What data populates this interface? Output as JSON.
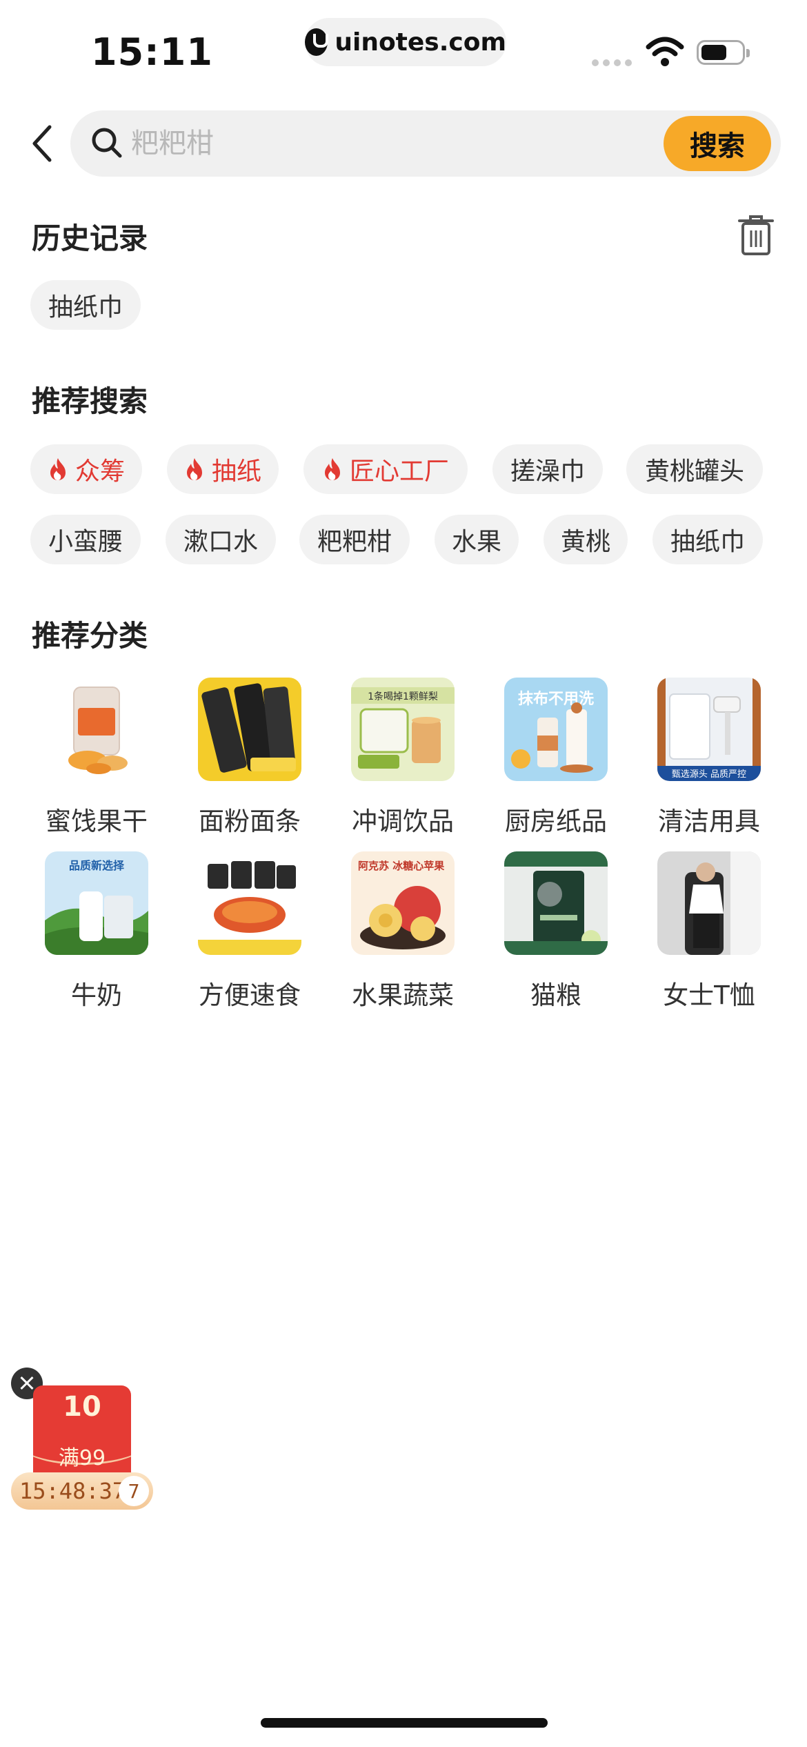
{
  "status_bar": {
    "time": "15:11",
    "url": "uinotes.com"
  },
  "search": {
    "placeholder": "粑粑柑",
    "button_label": "搜索"
  },
  "history": {
    "title": "历史记录",
    "items": [
      "抽纸巾"
    ]
  },
  "recommend_search": {
    "title": "推荐搜索",
    "items": [
      {
        "label": "众筹",
        "hot": true
      },
      {
        "label": "抽纸",
        "hot": true
      },
      {
        "label": "匠心工厂",
        "hot": true
      },
      {
        "label": "搓澡巾",
        "hot": false
      },
      {
        "label": "黄桃罐头",
        "hot": false
      },
      {
        "label": "小蛮腰",
        "hot": false
      },
      {
        "label": "漱口水",
        "hot": false
      },
      {
        "label": "粑粑柑",
        "hot": false
      },
      {
        "label": "水果",
        "hot": false
      },
      {
        "label": "黄桃",
        "hot": false
      },
      {
        "label": "抽纸巾",
        "hot": false
      }
    ]
  },
  "recommend_category": {
    "title": "推荐分类",
    "items": [
      {
        "label": "蜜饯果干",
        "icon": "dried-fruit-jar-image"
      },
      {
        "label": "面粉面条",
        "icon": "noodles-pack-image"
      },
      {
        "label": "冲调饮品",
        "icon": "drink-powder-image",
        "image_text": "1条喝掉1颗鲜梨"
      },
      {
        "label": "厨房纸品",
        "icon": "kitchen-paper-roll-image",
        "image_text": "抹布不用洗"
      },
      {
        "label": "清洁用具",
        "icon": "lint-roller-image",
        "image_text": "甄选源头 品质严控"
      },
      {
        "label": "牛奶",
        "icon": "milk-bottle-image",
        "image_text": "品质新选择"
      },
      {
        "label": "方便速食",
        "icon": "instant-food-image"
      },
      {
        "label": "水果蔬菜",
        "icon": "apple-fruit-image",
        "image_text": "阿克苏 冰糖心苹果"
      },
      {
        "label": "猫粮",
        "icon": "cat-food-bag-image"
      },
      {
        "label": "女士T恤",
        "icon": "women-tshirt-image"
      }
    ]
  },
  "coupon": {
    "amount": "10",
    "condition": "满99",
    "countdown": "15:48:37",
    "count": "7"
  },
  "colors": {
    "accent": "#f7a928",
    "hot": "#e23a33",
    "coupon": "#e53b34"
  }
}
